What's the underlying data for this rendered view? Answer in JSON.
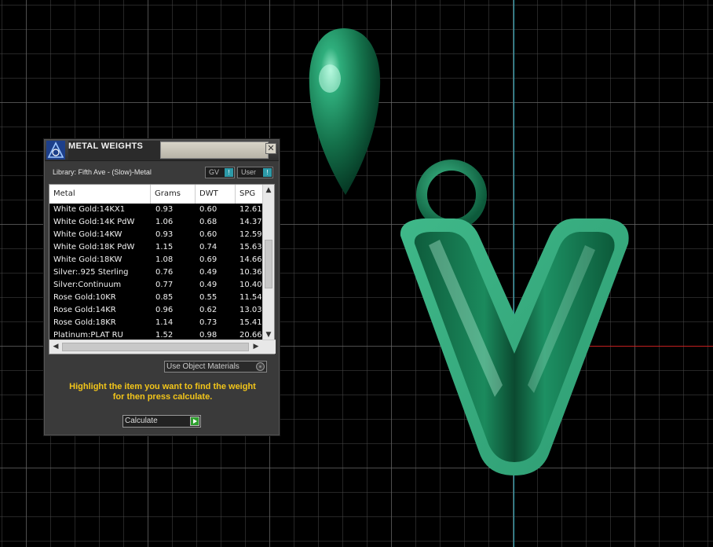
{
  "panel": {
    "title": "METAL WEIGHTS",
    "library_line": "Library: Fifth Ave - (Slow)-Metal",
    "gv_label": "GV",
    "user_label": "User",
    "toggle_mark": "!",
    "columns": [
      "Metal",
      "Grams",
      "DWT",
      "SPG"
    ],
    "rows": [
      {
        "metal": "White Gold:14KX1",
        "grams": "0.93",
        "dwt": "0.60",
        "spg": "12.61"
      },
      {
        "metal": "White Gold:14K PdW",
        "grams": "1.06",
        "dwt": "0.68",
        "spg": "14.37"
      },
      {
        "metal": "White Gold:14KW",
        "grams": "0.93",
        "dwt": "0.60",
        "spg": "12.59"
      },
      {
        "metal": "White Gold:18K PdW",
        "grams": "1.15",
        "dwt": "0.74",
        "spg": "15.63"
      },
      {
        "metal": "White Gold:18KW",
        "grams": "1.08",
        "dwt": "0.69",
        "spg": "14.66"
      },
      {
        "metal": "Silver:.925 Sterling",
        "grams": "0.76",
        "dwt": "0.49",
        "spg": "10.36"
      },
      {
        "metal": "Silver:Continuum",
        "grams": "0.77",
        "dwt": "0.49",
        "spg": "10.40"
      },
      {
        "metal": "Rose Gold:10KR",
        "grams": "0.85",
        "dwt": "0.55",
        "spg": "11.54"
      },
      {
        "metal": "Rose Gold:14KR",
        "grams": "0.96",
        "dwt": "0.62",
        "spg": "13.03"
      },
      {
        "metal": "Rose Gold:18KR",
        "grams": "1.14",
        "dwt": "0.73",
        "spg": "15.41"
      },
      {
        "metal": "Platinum:PLAT RU",
        "grams": "1.52",
        "dwt": "0.98",
        "spg": "20.66"
      }
    ],
    "use_object_materials": "Use Object Materials",
    "instructions_line1": "Highlight the item you want to find the weight",
    "instructions_line2": "for then press calculate.",
    "calculate_label": "Calculate",
    "close_glyph": "✕",
    "scroll_up": "▲",
    "scroll_down": "▼",
    "scroll_left": "◀",
    "scroll_right": "▶"
  },
  "colors": {
    "model_green": "#1f8a5c",
    "instruction_text": "#f2c51a",
    "grid_line": "#6e6e6e",
    "axis_vertical": "#2aa5b8",
    "axis_horizontal": "#c42020"
  },
  "icons": {
    "app_logo": "rhino-matrix-logo-icon",
    "close": "close-icon",
    "run": "play-icon"
  }
}
